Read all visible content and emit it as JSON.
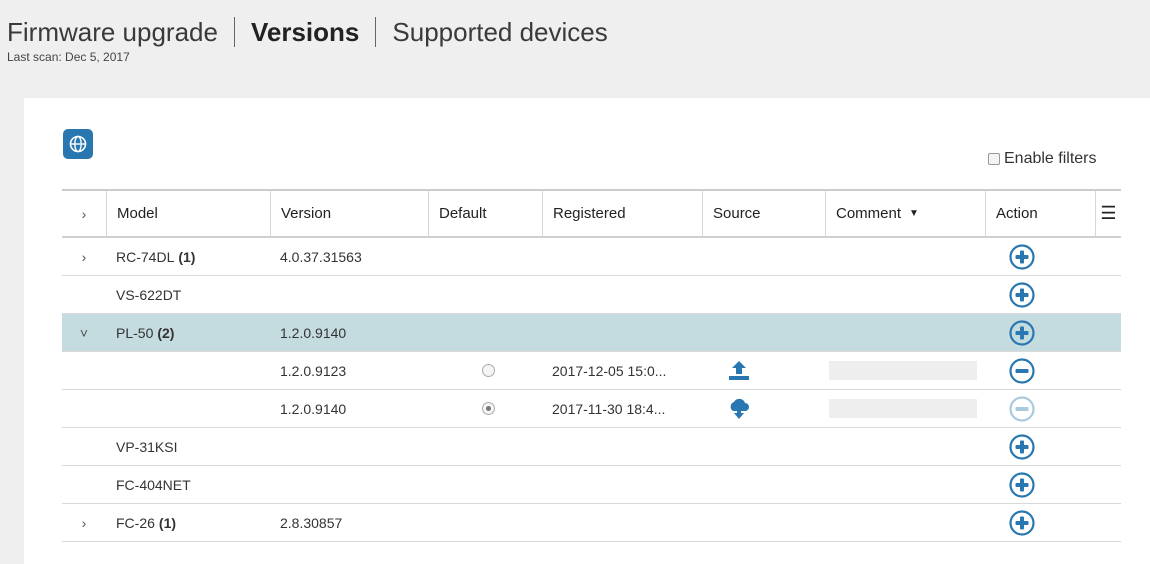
{
  "tabs": [
    {
      "label": "Firmware upgrade",
      "active": false
    },
    {
      "label": "Versions",
      "active": true
    },
    {
      "label": "Supported devices",
      "active": false
    }
  ],
  "last_scan": "Last scan: Dec 5, 2017",
  "toolbar": {
    "globe_icon": "globe-icon"
  },
  "filter": {
    "label": "Enable filters",
    "checked": false
  },
  "columns": {
    "expand": "›",
    "model": "Model",
    "version": "Version",
    "default": "Default",
    "registered": "Registered",
    "source": "Source",
    "comment": "Comment",
    "action": "Action"
  },
  "rows": [
    {
      "kind": "group",
      "chevron": "›",
      "model": "RC-74DL",
      "count": "(1)",
      "version": "4.0.37.31563",
      "action": "add"
    },
    {
      "kind": "group",
      "chevron": "",
      "model": "VS-622DT",
      "count": "",
      "version": "",
      "action": "add"
    },
    {
      "kind": "group",
      "chevron": "˅",
      "model": "PL-50",
      "count": "(2)",
      "version": "1.2.0.9140",
      "action": "add",
      "selected": true
    },
    {
      "kind": "child",
      "version": "1.2.0.9123",
      "default": false,
      "registered": "2017-12-05 15:0...",
      "source": "upload-icon",
      "action": "remove"
    },
    {
      "kind": "child",
      "version": "1.2.0.9140",
      "default": true,
      "registered": "2017-11-30 18:4...",
      "source": "cloud-download-icon",
      "action": "remove-disabled"
    },
    {
      "kind": "group",
      "chevron": "",
      "model": "VP-31KSI",
      "count": "",
      "version": "",
      "action": "add"
    },
    {
      "kind": "group",
      "chevron": "",
      "model": "FC-404NET",
      "count": "",
      "version": "",
      "action": "add"
    },
    {
      "kind": "group",
      "chevron": "›",
      "model": "FC-26",
      "count": "(1)",
      "version": "2.8.30857",
      "action": "add"
    }
  ],
  "colors": {
    "accent": "#2877b0",
    "selected_row": "#c4dbe0",
    "disabled_icon": "#a9c9df"
  }
}
